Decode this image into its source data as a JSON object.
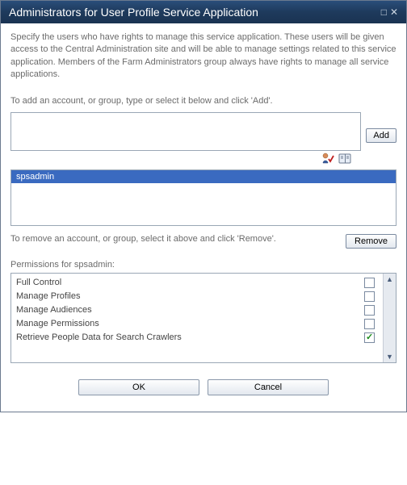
{
  "title": "Administrators for User Profile Service Application",
  "description": "Specify the users who have rights to manage this service application. These users will be given access to the Central Administration site and will be able to manage settings related to this service application. Members of the Farm Administrators group always have rights to manage all service applications.",
  "add_instruction": "To add an account, or group, type or select it below and click 'Add'.",
  "add_button": "Add",
  "input_value": "",
  "check_names_icon": "check-names-icon",
  "browse_icon": "browse-icon",
  "selected_account": "spsadmin",
  "remove_instruction": "To remove an account, or group, select it above and click 'Remove'.",
  "remove_button": "Remove",
  "permissions_label": "Permissions for spsadmin:",
  "permissions": [
    {
      "label": "Full Control",
      "checked": false
    },
    {
      "label": "Manage Profiles",
      "checked": false
    },
    {
      "label": "Manage Audiences",
      "checked": false
    },
    {
      "label": "Manage Permissions",
      "checked": false
    },
    {
      "label": "Retrieve People Data for Search Crawlers",
      "checked": true
    }
  ],
  "ok_button": "OK",
  "cancel_button": "Cancel"
}
